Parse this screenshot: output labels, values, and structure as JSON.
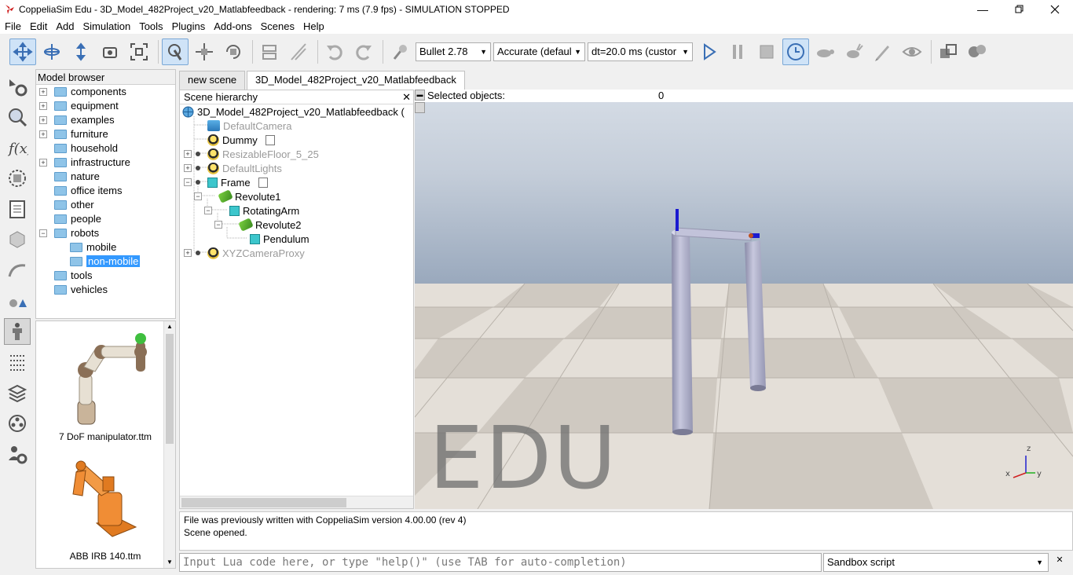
{
  "window": {
    "title": "CoppeliaSim Edu - 3D_Model_482Project_v20_Matlabfeedback - rendering: 7 ms (7.9 fps) - SIMULATION STOPPED",
    "controls": [
      "minimize-icon",
      "restore-icon",
      "close-icon"
    ]
  },
  "menu": [
    "File",
    "Edit",
    "Add",
    "Simulation",
    "Tools",
    "Plugins",
    "Add-ons",
    "Scenes",
    "Help"
  ],
  "toolbar": {
    "physics_engine": "Bullet 2.78",
    "accuracy": "Accurate (defaul",
    "timestep": "dt=20.0 ms (custor",
    "icons": [
      "camera-pan-icon",
      "camera-rotate-icon",
      "camera-shift-icon",
      "camera-angle-icon",
      "camera-fit-icon",
      "click-select-icon",
      "object-shift-icon",
      "object-rotate-icon",
      "assemble-icon",
      "transfer-dna-icon",
      "undo-icon",
      "redo-icon",
      "dynamic-content-icon",
      "play-icon",
      "pause-icon",
      "stop-icon",
      "realtime-icon",
      "slower-icon",
      "faster-icon",
      "thread-rendering-icon",
      "visualization-icon",
      "scene-page-icon",
      "scene-selection-icon"
    ]
  },
  "left_strip": [
    "simulation-settings-icon",
    "zoom-icon",
    "script-icon",
    "shape-edit-icon",
    "page-icon",
    "model-icon",
    "path-icon",
    "primitives-icon",
    "robot-icon",
    "selection-icon",
    "layers-icon",
    "video-icon",
    "user-settings-icon"
  ],
  "model_browser": {
    "header": "Model browser",
    "items": [
      {
        "label": "components",
        "expandable": true,
        "depth": 0
      },
      {
        "label": "equipment",
        "expandable": true,
        "depth": 0
      },
      {
        "label": "examples",
        "expandable": true,
        "depth": 0
      },
      {
        "label": "furniture",
        "expandable": true,
        "depth": 0
      },
      {
        "label": "household",
        "expandable": false,
        "depth": 0
      },
      {
        "label": "infrastructure",
        "expandable": true,
        "depth": 0
      },
      {
        "label": "nature",
        "expandable": false,
        "depth": 0
      },
      {
        "label": "office items",
        "expandable": false,
        "depth": 0
      },
      {
        "label": "other",
        "expandable": false,
        "depth": 0
      },
      {
        "label": "people",
        "expandable": false,
        "depth": 0
      },
      {
        "label": "robots",
        "expandable": true,
        "expanded": true,
        "depth": 0
      },
      {
        "label": "mobile",
        "expandable": false,
        "depth": 1
      },
      {
        "label": "non-mobile",
        "expandable": false,
        "depth": 1,
        "selected": true
      },
      {
        "label": "tools",
        "expandable": false,
        "depth": 0
      },
      {
        "label": "vehicles",
        "expandable": false,
        "depth": 0
      }
    ]
  },
  "model_thumbnails": [
    {
      "label": "7 DoF manipulator.ttm"
    },
    {
      "label": "ABB IRB 140.ttm"
    }
  ],
  "scene_tabs": [
    "new scene",
    "3D_Model_482Project_v20_Matlabfeedback"
  ],
  "hierarchy": {
    "header": "Scene hierarchy",
    "root": "3D_Model_482Project_v20_Matlabfeedback (",
    "items": [
      {
        "label": "DefaultCamera",
        "icon": "camera-icon",
        "dim": true
      },
      {
        "label": "Dummy",
        "icon": "dummy-icon",
        "dim": false
      },
      {
        "label": "ResizableFloor_5_25",
        "icon": "dummy-icon",
        "dim": true
      },
      {
        "label": "DefaultLights",
        "icon": "dummy-icon",
        "dim": true
      },
      {
        "label": "Frame",
        "icon": "cube-icon",
        "dim": false
      },
      {
        "label": "Revolute1",
        "icon": "joint-icon",
        "dim": false
      },
      {
        "label": "RotatingArm",
        "icon": "cube-icon",
        "dim": false
      },
      {
        "label": "Revolute2",
        "icon": "joint-icon",
        "dim": false
      },
      {
        "label": "Pendulum",
        "icon": "cube-icon",
        "dim": false
      },
      {
        "label": "XYZCameraProxy",
        "icon": "dummy-icon",
        "dim": true
      }
    ]
  },
  "viewport": {
    "selected_label": "Selected objects:",
    "selected_count": "0",
    "watermark": "EDU",
    "axes": {
      "z": "z",
      "x": "x",
      "y": "y"
    }
  },
  "console": {
    "lines": [
      "File was previously written with CoppeliaSim version 4.00.00 (rev 4)",
      "Scene opened."
    ],
    "input_placeholder": "Input Lua code here, or type \"help()\" (use TAB for auto-completion)",
    "script_selector": "Sandbox script"
  },
  "colors": {
    "selection": "#3399ff",
    "cube": "#3cc6cc",
    "folder": "#8fc4e8",
    "robot_part": "#b9bbd6"
  }
}
